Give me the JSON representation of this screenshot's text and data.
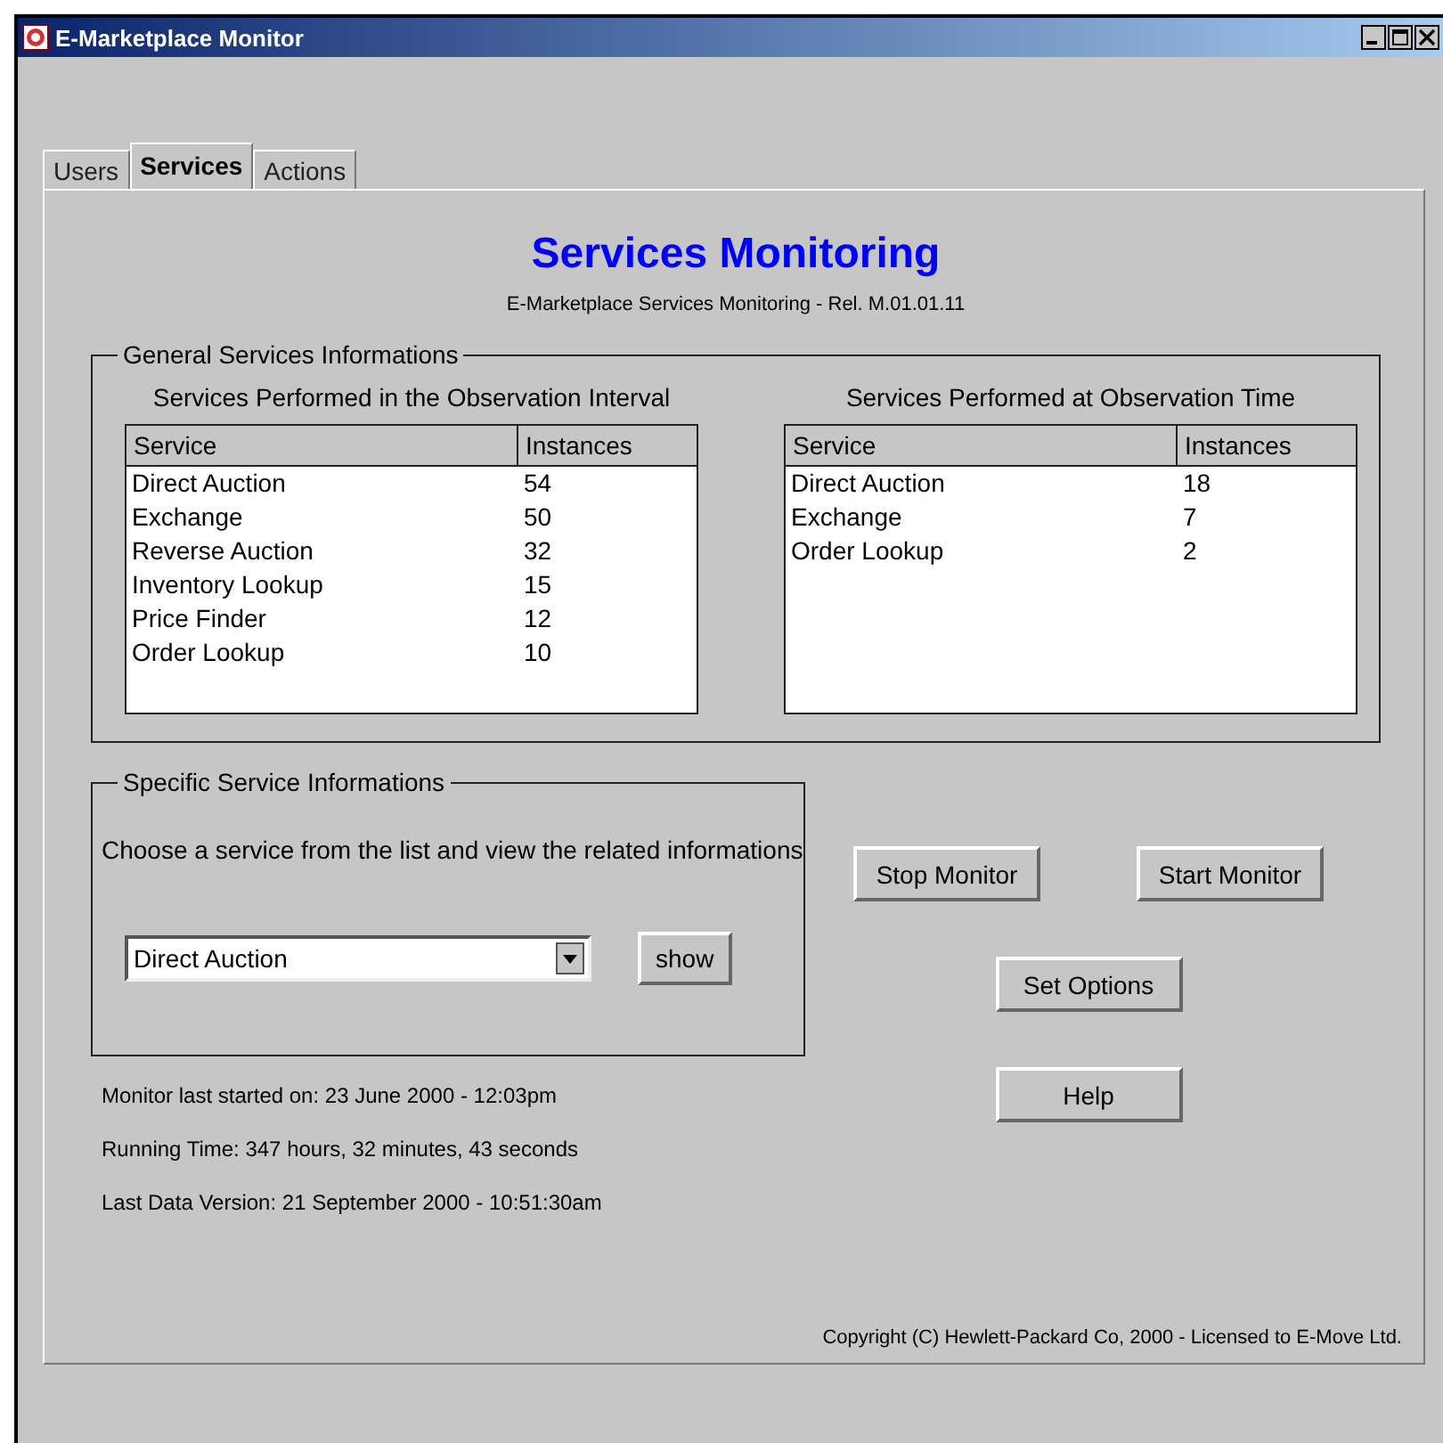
{
  "window": {
    "title": "E-Marketplace Monitor"
  },
  "tabs": [
    {
      "label": "Users",
      "selected": false
    },
    {
      "label": "Services",
      "selected": true
    },
    {
      "label": "Actions",
      "selected": false
    }
  ],
  "header": {
    "title": "Services Monitoring",
    "subtitle": "E-Marketplace Services Monitoring - Rel. M.01.01.11"
  },
  "general_services": {
    "title": "General Services Informations",
    "tables": [
      {
        "title": "Services Performed in the Observation Interval",
        "columns": [
          "Service",
          "Instances"
        ],
        "rows": [
          [
            "Direct Auction",
            "54"
          ],
          [
            "Exchange",
            "50"
          ],
          [
            "Reverse Auction",
            "32"
          ],
          [
            "Inventory Lookup",
            "15"
          ],
          [
            "Price Finder",
            "12"
          ],
          [
            "Order Lookup",
            "10"
          ]
        ]
      },
      {
        "title": "Services Performed at Observation Time",
        "columns": [
          "Service",
          "Instances"
        ],
        "rows": [
          [
            "Direct Auction",
            "18"
          ],
          [
            "Exchange",
            "7"
          ],
          [
            "Order Lookup",
            "2"
          ]
        ]
      }
    ]
  },
  "specific_service": {
    "title": "Specific Service Informations",
    "instruction": "Choose a service from the list and view the related informations",
    "dropdown": {
      "value": "Direct Auction"
    },
    "show_button": "show"
  },
  "status_lines": [
    "Monitor last started on: 23 June 2000 - 12:03pm",
    "Running Time: 347 hours, 32 minutes, 43 seconds",
    "Last Data Version: 21 September 2000 - 10:51:30am"
  ],
  "buttons": [
    "Stop Monitor",
    "Start Monitor",
    "Set Options",
    "Help"
  ],
  "copyright": "Copyright (C) Hewlett-Packard Co, 2000 - Licensed to E-Move Ltd."
}
